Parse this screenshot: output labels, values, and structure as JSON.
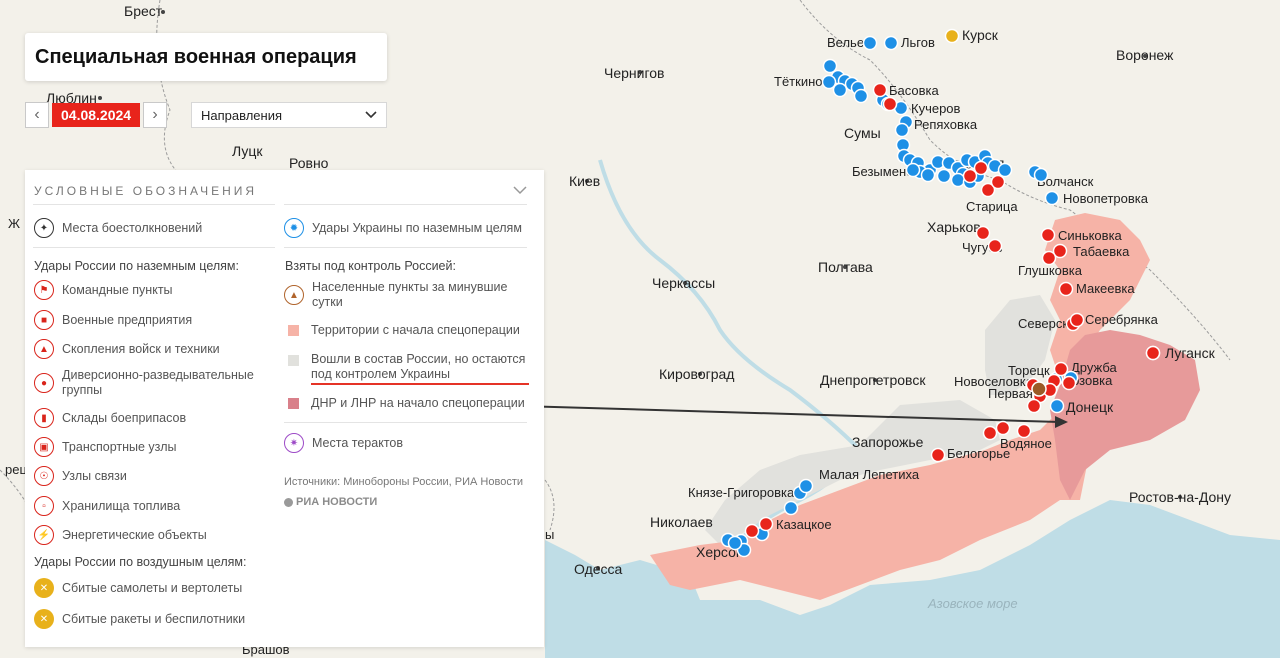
{
  "header": {
    "title": "Специальная военная операция"
  },
  "date_control": {
    "prev_icon": "chevron-left-icon",
    "date": "04.08.2024",
    "next_icon": "chevron-right-icon"
  },
  "direction_select": {
    "value": "Направления",
    "icon": "chevron-down-icon"
  },
  "legend": {
    "heading": "УСЛОВНЫЕ ОБОЗНАЧЕНИЯ",
    "collapse_icon": "chevron-down-icon",
    "clashes": "Места боестолкновений",
    "ukraine_strikes": "Удары Украины по наземным целям",
    "russia_ground_title": "Удары России по наземным целям:",
    "russia_ground": [
      "Командные пункты",
      "Военные предприятия",
      "Скопления войск и техники",
      "Диверсионно-разведывательные группы",
      "Склады боеприпасов",
      "Транспортные узлы",
      "Узлы связи",
      "Хранилища топлива",
      "Энергетические объекты"
    ],
    "russia_air_title": "Удары России по воздушным целям:",
    "russia_air": [
      "Сбитые самолеты и вертолеты",
      "Сбитые ракеты и беспилотники"
    ],
    "control_title": "Взяты под контроль Россией:",
    "settlements_day": "Населенные пункты за минувшие сутки",
    "territories": "Территории с начала спецоперации",
    "joined_under_ukraine": "Вошли в состав России, но остаются под контролем Украины",
    "dnr_lnr": "ДНР и ЛНР на начало спецоперации",
    "terror": "Места терактов",
    "sources": "Источники: Минобороны России, РИА Новости",
    "ria_logo": "РИА НОВОСТИ"
  },
  "colors": {
    "red_marker": "#e8241b",
    "blue_marker": "#1e90e6",
    "yellow_marker": "#e8b11b",
    "brown_marker": "#9b5a26",
    "territory_since_start": "#f6b3a7",
    "dnr_lnr_start": "#e79a9a",
    "joined_under_ukraine": "#e1e1dd",
    "sea": "#bfdde6"
  },
  "map_labels": {
    "brest": "Брест",
    "lublin": "Люблин",
    "lutsk": "Луцк",
    "rovno": "Ровно",
    "chernigov": "Чернигов",
    "kiev": "Киев",
    "sumy": "Сумы",
    "kursk": "Курск",
    "lgov": "Льгов",
    "velie": "Велье",
    "tyotkino": "Тёткино",
    "basovka": "Басовка",
    "kucherov": "Кучеров",
    "repyakhovka": "Репяховка",
    "belgorod": "Белгород",
    "bezymeno": "Безымено",
    "volchansk": "Волчанск",
    "novopetrovka": "Новопетровка",
    "staritsa": "Старица",
    "kharkov": "Харьков",
    "chuguev": "Чугуев",
    "voronezh": "Воронеж",
    "sinkovka": "Синьковка",
    "tabaevka": "Табаевка",
    "glushkovka": "Глушковка",
    "makeevka": "Макеевка",
    "seversk": "Северск",
    "serebryanka": "Серебрянка",
    "lugansk": "Луганск",
    "toretsk": "Торецк",
    "druzhba": "Дружба",
    "rozovka": "Розовка",
    "novoselovka": "Новоселовка",
    "pervaya": "Первая",
    "donetsk": "Донецк",
    "vodyanoe": "Водяное",
    "belogorye": "Белогорье",
    "poltava": "Полтава",
    "cherkassy": "Черкассы",
    "kirovograd": "Кировоград",
    "dnepropetrovsk": "Днепропетровск",
    "zaporozhye": "Запорожье",
    "malaya_lepetikha": "Малая Лепетиха",
    "knyaze_grigorovka": "Князе-Григоровка",
    "nikolaev": "Николаев",
    "kazatskoe": "Казацкое",
    "kherson": "Херсон",
    "odessa": "Одесса",
    "azov_sea": "Азовское море",
    "rostov": "Ростов-на-Дону",
    "brashov": "Брашов",
    "zh_partial": "Ж",
    "bre_partial": "рец",
    "y_partial": "ы"
  }
}
